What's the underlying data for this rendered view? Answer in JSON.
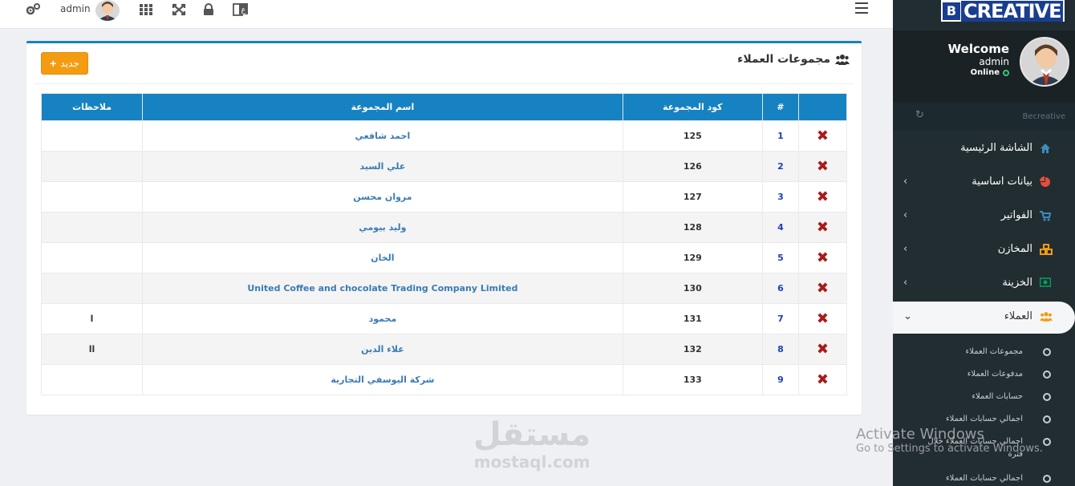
{
  "topbar": {
    "user_name": "admin",
    "icons": [
      "settings-icon",
      "user-avatar",
      "apps-grid-icon",
      "fullscreen-icon",
      "lock-icon",
      "language-icon",
      "menu-icon"
    ]
  },
  "panel": {
    "title": "مجموعات العملاء",
    "new_button": "جديد"
  },
  "table": {
    "headers": {
      "notes": "ملاحظات",
      "name": "اسم المجموعة",
      "code": "كود المجموعة",
      "num": "#"
    },
    "rows": [
      {
        "num": "1",
        "code": "125",
        "name": "احمد شافعي",
        "notes": ""
      },
      {
        "num": "2",
        "code": "126",
        "name": "علي السيد",
        "notes": ""
      },
      {
        "num": "3",
        "code": "127",
        "name": "مروان محسن",
        "notes": ""
      },
      {
        "num": "4",
        "code": "128",
        "name": "وليد بيومي",
        "notes": ""
      },
      {
        "num": "5",
        "code": "129",
        "name": "الخان",
        "notes": ""
      },
      {
        "num": "6",
        "code": "130",
        "name": "United Coffee and chocolate Trading Company Limited",
        "notes": ""
      },
      {
        "num": "7",
        "code": "131",
        "name": "محمود",
        "notes": "ا"
      },
      {
        "num": "8",
        "code": "132",
        "name": "علاء الدين",
        "notes": "اا"
      },
      {
        "num": "9",
        "code": "133",
        "name": "شركة اليوسفي التجارية",
        "notes": ""
      }
    ]
  },
  "watermark": {
    "ar": "مستقل",
    "en": "mostaql.com"
  },
  "activate": {
    "line1": "Activate Windows",
    "line2": "Go to Settings to activate Windows."
  },
  "sidebar": {
    "logo_letter": "B",
    "logo_word": "CREATIVE",
    "welcome": "Welcome",
    "user": "admin",
    "status": "Online",
    "search_label": "Becreative",
    "menu": [
      {
        "label": "الشاشة الرئيسية",
        "icon": "home-icon",
        "color": "#3c8dbc",
        "chevron": ""
      },
      {
        "label": "بيانات اساسية",
        "icon": "pie-chart-icon",
        "color": "#e74c3c",
        "chevron": "‹"
      },
      {
        "label": "الفواتير",
        "icon": "cart-icon",
        "color": "#3c8dbc",
        "chevron": "‹"
      },
      {
        "label": "المخازن",
        "icon": "cubes-icon",
        "color": "#f39c12",
        "chevron": "‹"
      },
      {
        "label": "الخزينة",
        "icon": "money-icon",
        "color": "#00a65a",
        "chevron": "‹"
      },
      {
        "label": "العملاء",
        "icon": "users-icon",
        "color": "#f39c12",
        "chevron": "⌄"
      }
    ],
    "submenu": [
      "مجموعات العملاء",
      "مدفوعات العملاء",
      "حسابات العملاء",
      "اجمالي حسابات العملاء",
      "اجمالي حسابات العملاء خلال فترة",
      "اجمالي حسابات العملاء"
    ]
  }
}
